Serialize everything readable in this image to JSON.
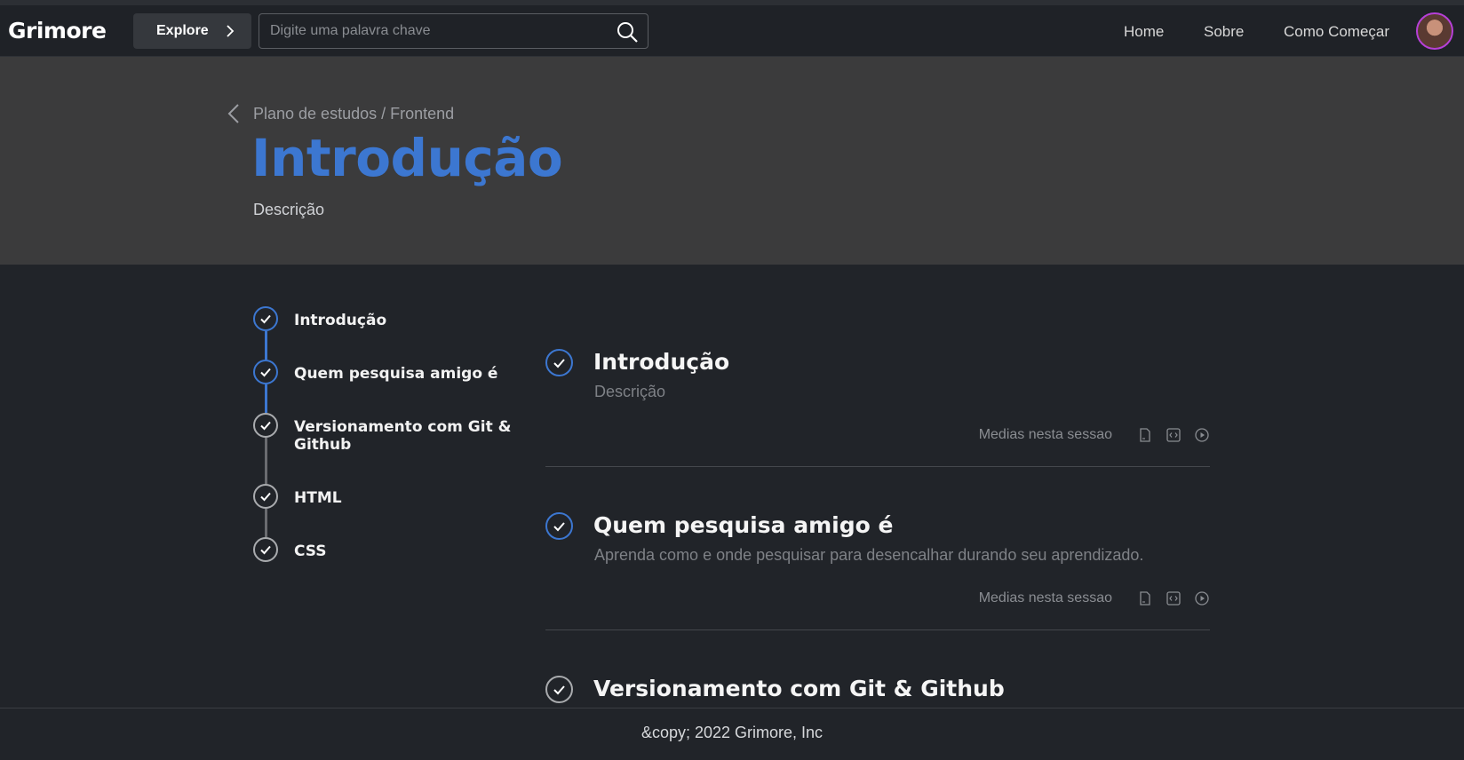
{
  "brand": {
    "logo": "Grimore"
  },
  "header": {
    "explore_label": "Explore",
    "search_placeholder": "Digite uma palavra chave",
    "search_value": "",
    "nav": [
      "Home",
      "Sobre",
      "Como Começar"
    ],
    "avatar_ring_color": "#b640d8"
  },
  "hero": {
    "breadcrumb": "Plano de estudos / Frontend",
    "title": "Introdução",
    "description": "Descrição",
    "title_color": "#3c77d1"
  },
  "timeline": {
    "items": [
      {
        "label": "Introdução",
        "state": "active"
      },
      {
        "label": "Quem pesquisa amigo é",
        "state": "active"
      },
      {
        "label": "Versionamento com Git & Github",
        "state": "inactive"
      },
      {
        "label": "HTML",
        "state": "inactive"
      },
      {
        "label": "CSS",
        "state": "inactive"
      }
    ],
    "active_color": "#3c77d1",
    "inactive_color": "#a9abae"
  },
  "sections": [
    {
      "title": "Introdução",
      "description": "Descrição",
      "medias_label": "Medias nesta sessao",
      "media_icons": [
        "file-icon",
        "code-icon",
        "play-icon"
      ],
      "state": "active"
    },
    {
      "title": "Quem pesquisa amigo é",
      "description": "Aprenda como e onde pesquisar para desencalhar durando seu aprendizado.",
      "medias_label": "Medias nesta sessao",
      "media_icons": [
        "file-icon",
        "code-icon",
        "play-icon"
      ],
      "state": "active"
    },
    {
      "title": "Versionamento com Git & Github",
      "state": "inactive"
    }
  ],
  "footer": {
    "text": "&copy; 2022 Grimore, Inc"
  }
}
